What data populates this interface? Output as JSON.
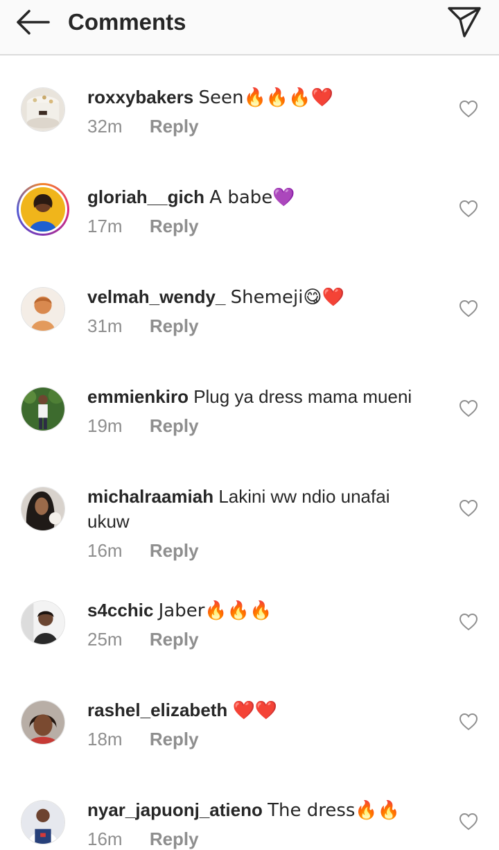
{
  "header": {
    "title": "Comments",
    "icons": {
      "back": "arrow-left-icon",
      "send": "paper-plane-icon"
    }
  },
  "reply_label": "Reply",
  "comments": [
    {
      "username": "roxxybakers",
      "text": "Seen🔥🔥🔥❤️",
      "time": "32m"
    },
    {
      "username": "gloriah__gich",
      "text": "A babe💜",
      "time": "17m"
    },
    {
      "username": "velmah_wendy_",
      "text": "Shemeji😋❤️",
      "time": "31m"
    },
    {
      "username": "emmienkiro",
      "text": "Plug ya dress mama mueni",
      "time": "19m"
    },
    {
      "username": "michalraamiah",
      "text": "Lakini ww ndio unafai ukuw",
      "time": "16m"
    },
    {
      "username": "s4cchic",
      "text": "Jaber🔥🔥🔥",
      "time": "25m"
    },
    {
      "username": "rashel_elizabeth",
      "text": "❤️❤️",
      "time": "18m"
    },
    {
      "username": "nyar_japuonj_atieno",
      "text": "The dress🔥🔥",
      "time": "16m"
    }
  ],
  "colors": {
    "secondary_text": "#8e8e8e",
    "divider": "#dbdbdb",
    "header_bg": "#fafafa"
  }
}
